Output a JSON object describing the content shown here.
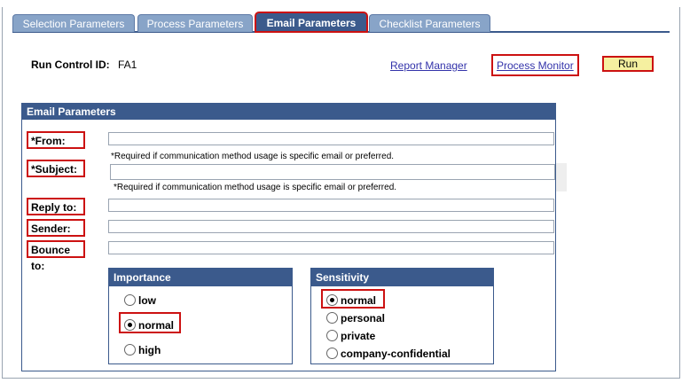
{
  "tabs": [
    "Selection Parameters",
    "Process Parameters",
    "Email Parameters",
    "Checklist Parameters"
  ],
  "run_control": {
    "label": "Run Control ID:",
    "value": "FA1"
  },
  "links": {
    "report_manager": "Report Manager",
    "process_monitor": "Process Monitor"
  },
  "run_button": "Run",
  "panel": {
    "title": "Email Parameters",
    "from_label": "*From:",
    "subject_label": "*Subject:",
    "reply_to_label": "Reply to:",
    "sender_label": "Sender:",
    "bounce_to_label": "Bounce to:",
    "note_from": "*Required if communication method usage is specific email or preferred.",
    "note_subject": "*Required if communication method usage is specific email or preferred.",
    "from_value": "",
    "subject_value": "",
    "reply_to_value": "",
    "sender_value": "",
    "bounce_to_value": ""
  },
  "importance": {
    "title": "Importance",
    "options": [
      "low",
      "normal",
      "high"
    ],
    "selected": "normal"
  },
  "sensitivity": {
    "title": "Sensitivity",
    "options": [
      "normal",
      "personal",
      "private",
      "company-confidential"
    ],
    "selected": "normal"
  }
}
